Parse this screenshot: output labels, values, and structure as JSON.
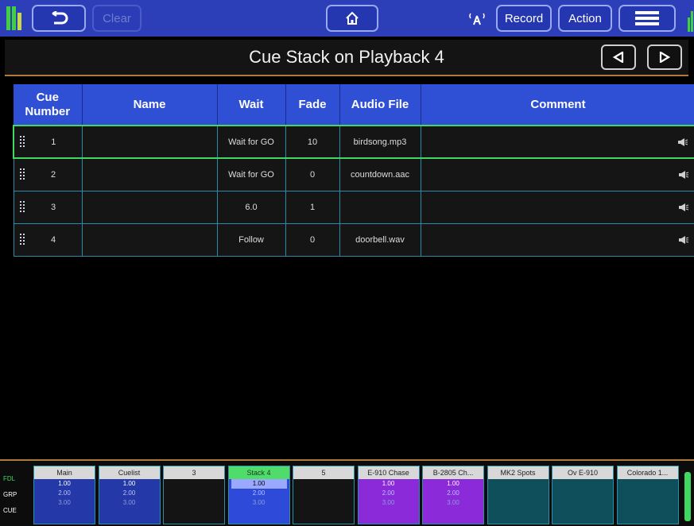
{
  "toolbar": {
    "undo_icon": "undo-icon",
    "clear_label": "Clear",
    "home_icon": "home-icon",
    "wifi_icon": "wireless-icon",
    "record_label": "Record",
    "action_label": "Action",
    "menu_icon": "hamburger-icon"
  },
  "header": {
    "title": "Cue Stack on Playback 4",
    "prev_icon": "triangle-left-icon",
    "next_icon": "triangle-right-icon"
  },
  "table": {
    "columns": [
      "Cue Number",
      "Name",
      "Wait",
      "Fade",
      "Audio File",
      "Comment"
    ],
    "rows": [
      {
        "cue": "1",
        "name": "",
        "wait": "Wait for GO",
        "fade": "10",
        "audio": "birdsong.mp3",
        "comment": "",
        "active": true
      },
      {
        "cue": "2",
        "name": "",
        "wait": "Wait for GO",
        "fade": "0",
        "audio": "countdown.aac",
        "comment": "",
        "active": false
      },
      {
        "cue": "3",
        "name": "",
        "wait": "6.0",
        "fade": "1",
        "audio": "",
        "comment": "",
        "active": false
      },
      {
        "cue": "4",
        "name": "",
        "wait": "Follow",
        "fade": "0",
        "audio": "doorbell.wav",
        "comment": "",
        "active": false
      }
    ]
  },
  "playback_bar": {
    "row_labels": [
      "FDL",
      "GRP",
      "CUE"
    ],
    "playbacks": [
      {
        "name": "Main",
        "v1": "1.00",
        "v2": "2.00",
        "v3": "3.00",
        "style": "blue"
      },
      {
        "name": "Cuelist",
        "v1": "1.00",
        "v2": "2.00",
        "v3": "3.00",
        "style": "blue"
      },
      {
        "name": "3",
        "v1": "",
        "v2": "",
        "v3": "",
        "style": "empty"
      },
      {
        "name": "Stack 4",
        "v1": "1.00",
        "v2": "2.00",
        "v3": "3.00",
        "style": "stack"
      },
      {
        "name": "5",
        "v1": "",
        "v2": "",
        "v3": "",
        "style": "empty"
      },
      {
        "name": "E-910 Chase",
        "v1": "1.00",
        "v2": "2.00",
        "v3": "3.00",
        "style": "purple"
      },
      {
        "name": "B-2805 Ch...",
        "v1": "1.00",
        "v2": "2.00",
        "v3": "3.00",
        "style": "purple"
      },
      {
        "name": "MK2 Spots",
        "v1": "",
        "v2": "",
        "v3": "",
        "style": "teal"
      },
      {
        "name": "Ov E-910",
        "v1": "",
        "v2": "",
        "v3": "",
        "style": "teal"
      },
      {
        "name": "Colorado 1...",
        "v1": "",
        "v2": "",
        "v3": "",
        "style": "teal"
      }
    ]
  },
  "colors": {
    "toolbar_bg": "#2c3eb8",
    "header_accent": "#b07a3a",
    "table_header": "#2f4fd4",
    "active_row_border": "#40d860",
    "cell_border": "#2a8aa8"
  }
}
